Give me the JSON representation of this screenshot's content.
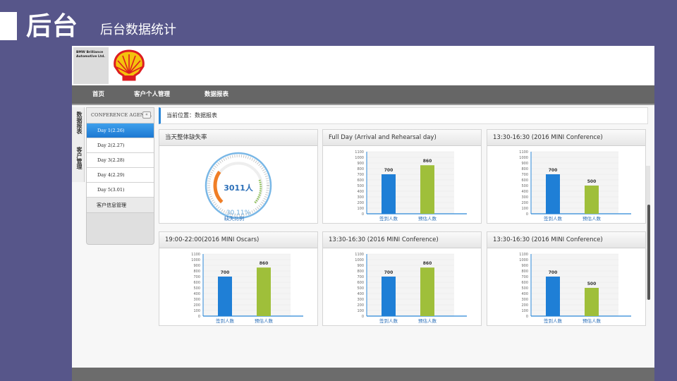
{
  "slide": {
    "title": "后台",
    "subtitle": "后台数据统计"
  },
  "brand": {
    "bmw_text": "BMW Brilliance Automotive Ltd.",
    "shell_icon": "shell-logo-icon"
  },
  "nav": [
    "首页",
    "客户个人管理",
    "数据报表"
  ],
  "vtabs": [
    "数据报表",
    "客户管理"
  ],
  "side": {
    "heading": "CONFERENCE AGENDA",
    "collapse": "«",
    "days": [
      "Day 1(2.26)",
      "Day 2(2.27)",
      "Day 3(2.28)",
      "Day 4(2.29)",
      "Day 5(3.01)"
    ],
    "active_index": 0,
    "mgmt": "客户信息管理"
  },
  "breadcrumb": "当前位置：数据报表",
  "gauge": {
    "title": "当天整体缺失率",
    "count": "3011人",
    "percent": "30.11%",
    "label": "缺失比例",
    "value_fraction": 0.3011
  },
  "colors": {
    "blue_bar": "#1f7fd6",
    "green_bar": "#9fbf3a",
    "gauge_orange": "#f07e26",
    "gauge_text": "#2b6fb8"
  },
  "chart_data": [
    {
      "type": "bar",
      "title": "Full Day (Arrival and Rehearsal day)",
      "categories": [
        "签到人数",
        "预估人数"
      ],
      "values": [
        700,
        860
      ],
      "ylim": [
        0,
        1100
      ],
      "yticks": [
        0,
        100,
        200,
        300,
        400,
        500,
        600,
        700,
        800,
        900,
        1000,
        1100
      ]
    },
    {
      "type": "bar",
      "title": "13:30-16:30 (2016 MINI Conference)",
      "categories": [
        "签到人数",
        "预估人数"
      ],
      "values": [
        700,
        500
      ],
      "ylim": [
        0,
        1100
      ],
      "yticks": [
        0,
        100,
        200,
        300,
        400,
        500,
        600,
        700,
        800,
        900,
        1000,
        1100
      ]
    },
    {
      "type": "bar",
      "title": "19:00-22:00(2016 MINI Oscars)",
      "categories": [
        "签到人数",
        "预估人数"
      ],
      "values": [
        700,
        860
      ],
      "ylim": [
        0,
        1100
      ],
      "yticks": [
        0,
        100,
        200,
        300,
        400,
        500,
        600,
        700,
        800,
        900,
        1000,
        1100
      ]
    },
    {
      "type": "bar",
      "title": "13:30-16:30 (2016 MINI Conference)",
      "categories": [
        "签到人数",
        "预估人数"
      ],
      "values": [
        700,
        860
      ],
      "ylim": [
        0,
        1100
      ],
      "yticks": [
        0,
        100,
        200,
        300,
        400,
        500,
        600,
        700,
        800,
        900,
        1000,
        1100
      ]
    },
    {
      "type": "bar",
      "title": "13:30-16:30 (2016 MINI Conference)",
      "categories": [
        "签到人数",
        "预估人数"
      ],
      "values": [
        700,
        500
      ],
      "ylim": [
        0,
        1100
      ],
      "yticks": [
        0,
        100,
        200,
        300,
        400,
        500,
        600,
        700,
        800,
        900,
        1000,
        1100
      ]
    }
  ]
}
